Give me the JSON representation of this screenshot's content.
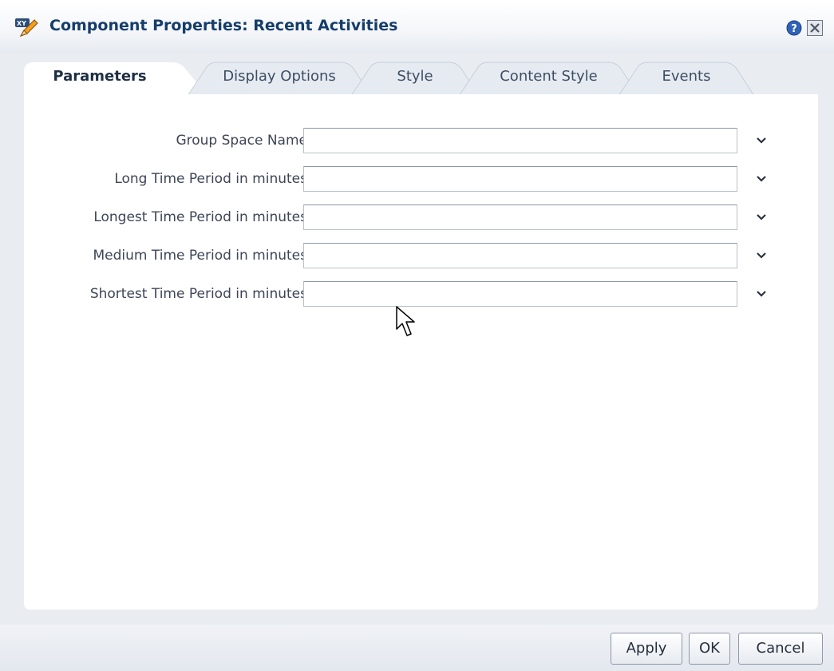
{
  "window": {
    "title": "Component Properties: Recent Activities",
    "accent_color": "#153d6b"
  },
  "tabs": [
    {
      "label": "Parameters",
      "active": true
    },
    {
      "label": "Display Options",
      "active": false
    },
    {
      "label": "Style",
      "active": false
    },
    {
      "label": "Content Style",
      "active": false
    },
    {
      "label": "Events",
      "active": false
    }
  ],
  "form": {
    "fields": [
      {
        "label": "Group Space Name",
        "value": ""
      },
      {
        "label": "Long Time Period in minutes",
        "value": ""
      },
      {
        "label": "Longest Time Period in minutes",
        "value": ""
      },
      {
        "label": "Medium Time Period in minutes",
        "value": ""
      },
      {
        "label": "Shortest Time Period in minutes",
        "value": ""
      }
    ]
  },
  "footer": {
    "apply_label": "Apply",
    "ok_label": "OK",
    "cancel_label": "Cancel"
  },
  "icons": {
    "app": "xy-pencil-icon",
    "help": "help-icon",
    "close": "close-icon",
    "dropdown": "chevron-down-icon",
    "pointer": "mouse-cursor-icon"
  }
}
